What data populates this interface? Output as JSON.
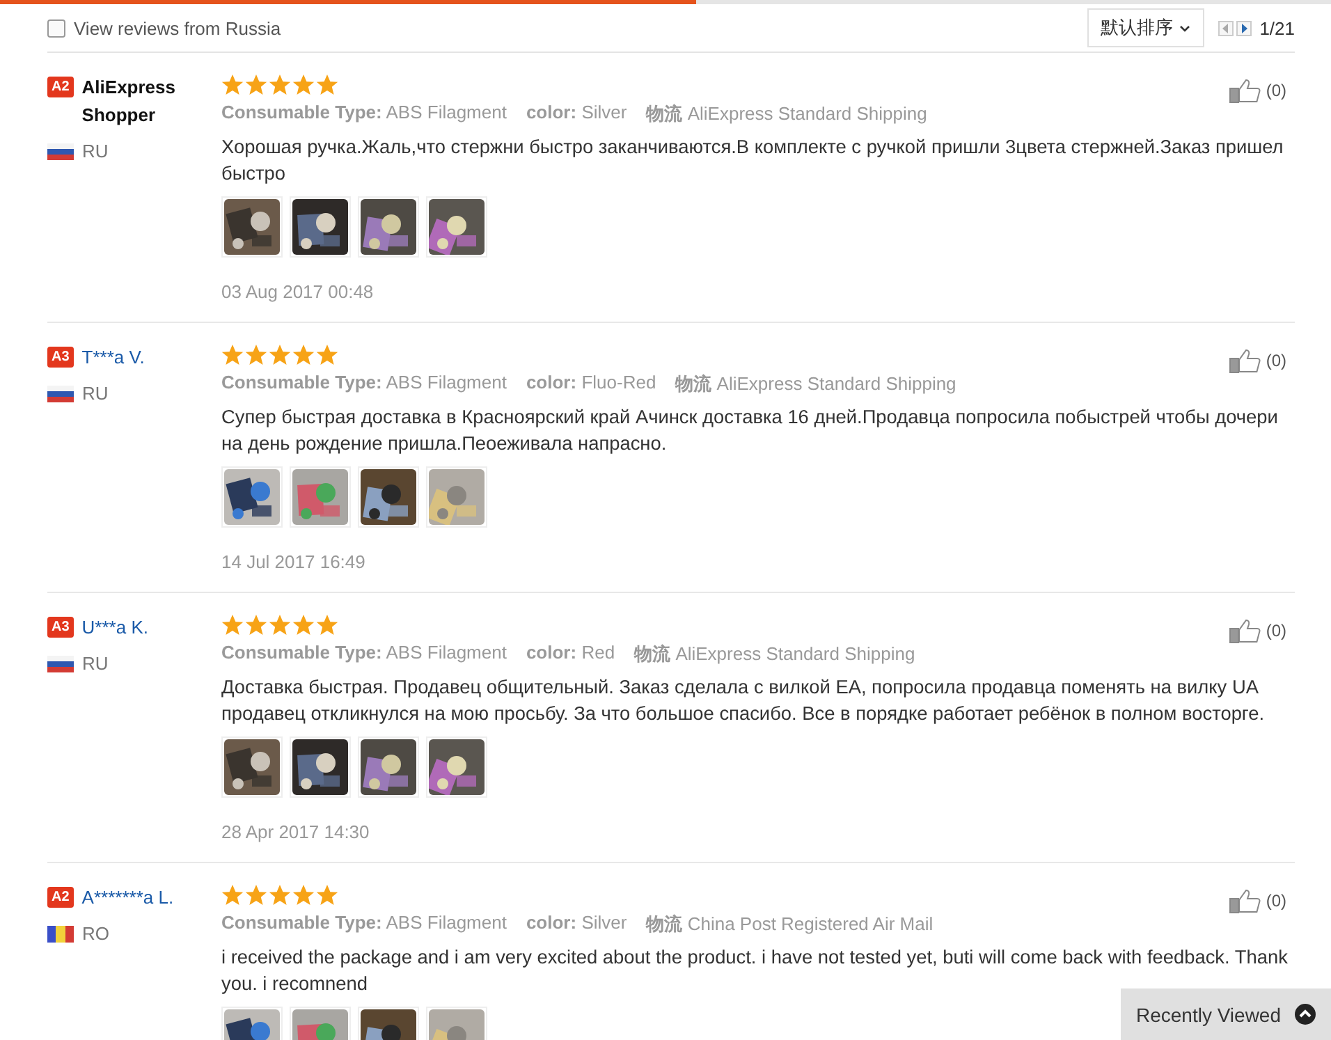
{
  "filter": {
    "label": "View reviews from Russia",
    "checked": false
  },
  "sort": {
    "label": "默认排序"
  },
  "pager": {
    "page": "1/21"
  },
  "reviews": [
    {
      "badge": "A2",
      "name": "AliExpress Shopper",
      "linked": false,
      "flag": {
        "kind": "ru"
      },
      "country": "RU",
      "stars": 5,
      "meta": [
        {
          "label": "Consumable Type:",
          "value": "ABS Filagment"
        },
        {
          "label": "color:",
          "value": "Silver"
        },
        {
          "label": "物流",
          "value": "AliExpress Standard Shipping"
        }
      ],
      "text": "Хорошая ручка.Жаль,что стержни быстро заканчиваются.В комплекте с ручкой пришли 3цвета стержней.Заказ пришел быстро",
      "photos": [
        {
          "kind": "picture"
        },
        {
          "kind": "picture"
        },
        {
          "kind": "picture"
        },
        {
          "kind": "picture"
        }
      ],
      "date": "03 Aug 2017 00:48",
      "likes": "(0)"
    },
    {
      "badge": "A3",
      "name": "T***a V.",
      "linked": true,
      "flag": {
        "kind": "ru"
      },
      "country": "RU",
      "stars": 5,
      "meta": [
        {
          "label": "Consumable Type:",
          "value": "ABS Filagment"
        },
        {
          "label": "color:",
          "value": "Fluo-Red"
        },
        {
          "label": "物流",
          "value": "AliExpress Standard Shipping"
        }
      ],
      "text": "Супер быстрая доставка в Красноярский край Ачинск доставка 16 дней.Продавца попросила побыстрей чтобы дочери на день рождение пришла.Пеоеживала напрасно.",
      "photos": [
        {
          "kind": "picture"
        },
        {
          "kind": "picture"
        },
        {
          "kind": "picture"
        },
        {
          "kind": "picture"
        }
      ],
      "date": "14 Jul 2017 16:49",
      "likes": "(0)"
    },
    {
      "badge": "A3",
      "name": "U***a K.",
      "linked": true,
      "flag": {
        "kind": "ru"
      },
      "country": "RU",
      "stars": 5,
      "meta": [
        {
          "label": "Consumable Type:",
          "value": "ABS Filagment"
        },
        {
          "label": "color:",
          "value": "Red"
        },
        {
          "label": "物流",
          "value": "AliExpress Standard Shipping"
        }
      ],
      "text": "Доставка быстрая. Продавец общительный. Заказ сделала с вилкой EA, попросила продавца поменять на вилку UA продавец откликнулся на мою просьбу. За что большое спасибо. Все в порядке работает ребёнок в полном восторге.",
      "photos": [
        {
          "kind": "picture"
        },
        {
          "kind": "picture"
        },
        {
          "kind": "picture"
        },
        {
          "kind": "picture"
        }
      ],
      "date": "28 Apr 2017 14:30",
      "likes": "(0)"
    },
    {
      "badge": "A2",
      "name": "A*******a L.",
      "linked": true,
      "flag": {
        "kind": "ro"
      },
      "country": "RO",
      "stars": 5,
      "meta": [
        {
          "label": "Consumable Type:",
          "value": "ABS Filagment"
        },
        {
          "label": "color:",
          "value": "Silver"
        },
        {
          "label": "物流",
          "value": "China Post Registered Air Mail"
        }
      ],
      "text": "i received the package and i am very excited about the product. i have not tested yet, buti will come back with feedback. Thank you. i recomnend",
      "photos": [
        {
          "kind": "picture"
        },
        {
          "kind": "picture"
        },
        {
          "kind": "picture"
        },
        {
          "kind": "picture"
        }
      ],
      "likes": "(0)"
    }
  ],
  "recently_viewed": {
    "label": "Recently Viewed"
  }
}
